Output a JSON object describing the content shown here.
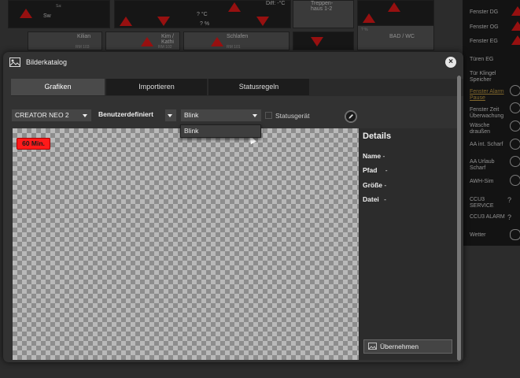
{
  "background": {
    "tiles": [
      {
        "label": "Sw",
        "sub": "Sa:"
      },
      {
        "label": "? °C",
        "sub": "? %"
      },
      {
        "label": "Diff: -°C",
        "sub": ""
      },
      {
        "label": "Treppen-haus 1-2",
        "sub": ""
      },
      {
        "label": "Kilian",
        "sub": "RM 103"
      },
      {
        "label": "Kim / Kathi",
        "sub": "RM 102"
      },
      {
        "label": "Schlafen",
        "sub": "RM 101"
      },
      {
        "label": "BAD / WC",
        "sub": "? %"
      }
    ],
    "right_list": [
      {
        "label": "Fenster DG",
        "link": false
      },
      {
        "label": "Fenster OG",
        "link": false
      },
      {
        "label": "Fenster EG",
        "link": false
      },
      {
        "label": "Türen EG",
        "link": false
      },
      {
        "label": "Tür Klingel Speicher",
        "link": false
      },
      {
        "label": "Fenster Alarm Pause",
        "link": true
      },
      {
        "label": "Fenster Zeit Überwachung",
        "link": false
      },
      {
        "label": "Wäsche draußen",
        "link": false
      },
      {
        "label": "AA int. Scharf",
        "link": false
      },
      {
        "label": "AA Urlaub Scharf",
        "link": false
      },
      {
        "label": "AWH-Sim",
        "link": false
      },
      {
        "label": "CCU3 SERVICE",
        "link": false
      },
      {
        "label": "CCU3 ALARM",
        "link": false
      },
      {
        "label": "Wetter",
        "link": false
      }
    ],
    "question_mark": "?"
  },
  "dialog": {
    "title": "Bilderkatalog",
    "close_label": "×",
    "tabs": [
      "Grafiken",
      "Importieren",
      "Statusregeln"
    ],
    "active_tab": "Grafiken",
    "toolbar": {
      "device_select": "CREATOR NEO 2",
      "category_select": "Benutzerdefiniert",
      "variant_select": "Blink",
      "status_device_label": "Statusgerät"
    },
    "dropdown_options": [
      "Blink"
    ],
    "preview_badge": "60 Min.",
    "details": {
      "title": "Details",
      "fields": [
        {
          "label": "Name",
          "value": "-"
        },
        {
          "label": "Pfad",
          "value": "-"
        },
        {
          "label": "Größe",
          "value": "-"
        },
        {
          "label": "Datei",
          "value": "-"
        }
      ]
    },
    "apply_label": "Übernehmen"
  },
  "icons": {
    "dialog": "image-icon",
    "close": "close-icon",
    "edit": "pencil-icon",
    "apply": "image-icon",
    "dropdown": "chevron-down-icon"
  },
  "colors": {
    "alarm_red": "#e81a1a",
    "badge_red": "#ff1a1a",
    "link_gold": "#c8a046",
    "dialog_bg": "#323232"
  }
}
